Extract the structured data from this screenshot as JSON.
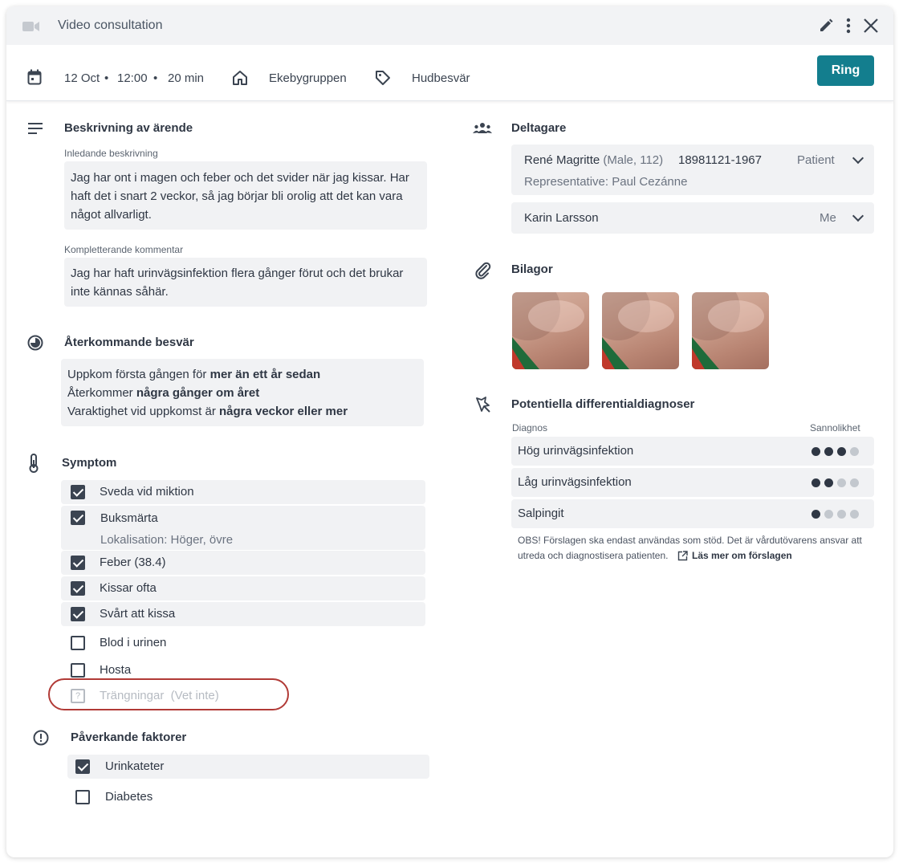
{
  "header": {
    "title": "Video consultation",
    "camera_icon": "video-camera-icon",
    "edit_icon": "pencil-icon",
    "more_icon": "more-vertical-icon",
    "close_icon": "close-icon"
  },
  "info": {
    "date": "12 Oct",
    "separator": "•",
    "time": "12:00",
    "duration": "20 min",
    "clinic": "Ekebygruppen",
    "category": "Hudbesvär",
    "ring_label": "Ring"
  },
  "description": {
    "title": "Beskrivning av ärende",
    "initial_label": "Inledande beskrivning",
    "initial_text": "Jag har ont i magen och feber och det svider när jag kissar. Har haft det i snart 2 veckor, så jag börjar bli orolig att det kan vara något allvarligt.",
    "complement_label": "Kompletterande kommentar",
    "complement_text": "Jag har haft urinvägsinfektion flera gånger förut och det brukar inte kännas såhär."
  },
  "recurring": {
    "title": "Återkommande besvär",
    "line1_prefix": "Uppkom första gången för ",
    "line1_bold": "mer än ett år  sedan",
    "line2_prefix": "Återkommer ",
    "line2_bold": "några gånger om året",
    "line3_prefix": "Varaktighet vid uppkomst är ",
    "line3_bold": "några veckor eller mer"
  },
  "symptoms": {
    "title": "Symptom",
    "items": [
      {
        "label": "Sveda vid miktion",
        "checked": true
      },
      {
        "label": "Buksmärta",
        "checked": true,
        "detail": "Lokalisation: Höger, övre"
      },
      {
        "label": "Feber (38.4)",
        "checked": true
      },
      {
        "label": "Kissar ofta",
        "checked": true
      },
      {
        "label": "Svårt att kissa",
        "checked": true
      },
      {
        "label": "Blod i urinen",
        "checked": false
      },
      {
        "label": "Hosta",
        "checked": false
      },
      {
        "label": "Trängningar",
        "unknown_label": "(Vet inte)",
        "unknown_mark": "?",
        "state": "unknown"
      }
    ]
  },
  "factors": {
    "title": "Påverkande faktorer",
    "items": [
      {
        "label": "Urinkateter",
        "checked": true
      },
      {
        "label": "Diabetes",
        "checked": false
      }
    ]
  },
  "participants": {
    "title": "Deltagare",
    "patient_name": "René Magritte",
    "patient_meta": "(Male, 112)",
    "patient_id": "18981121-1967",
    "patient_role": "Patient",
    "representative": "Representative: Paul Cezánne",
    "staff_name": "Karin Larsson",
    "staff_role": "Me"
  },
  "attachments": {
    "title": "Bilagor",
    "count": 3
  },
  "diagnoses": {
    "title": "Potentiella differentialdiagnoser",
    "col_diagnosis": "Diagnos",
    "col_probability": "Sannolikhet",
    "items": [
      {
        "name": "Hög urinvägsinfektion",
        "level": 3,
        "max": 4
      },
      {
        "name": "Låg urinvägsinfektion",
        "level": 2,
        "max": 4
      },
      {
        "name": "Salpingit",
        "level": 1,
        "max": 4
      }
    ],
    "disclaimer_line1": "OBS! Förslagen ska endast användas som stöd. Det är vårdutövarens ansvar att",
    "disclaimer_line2": "utreda och diagnostisera patienten.",
    "read_more": "Läs mer om förslagen"
  }
}
